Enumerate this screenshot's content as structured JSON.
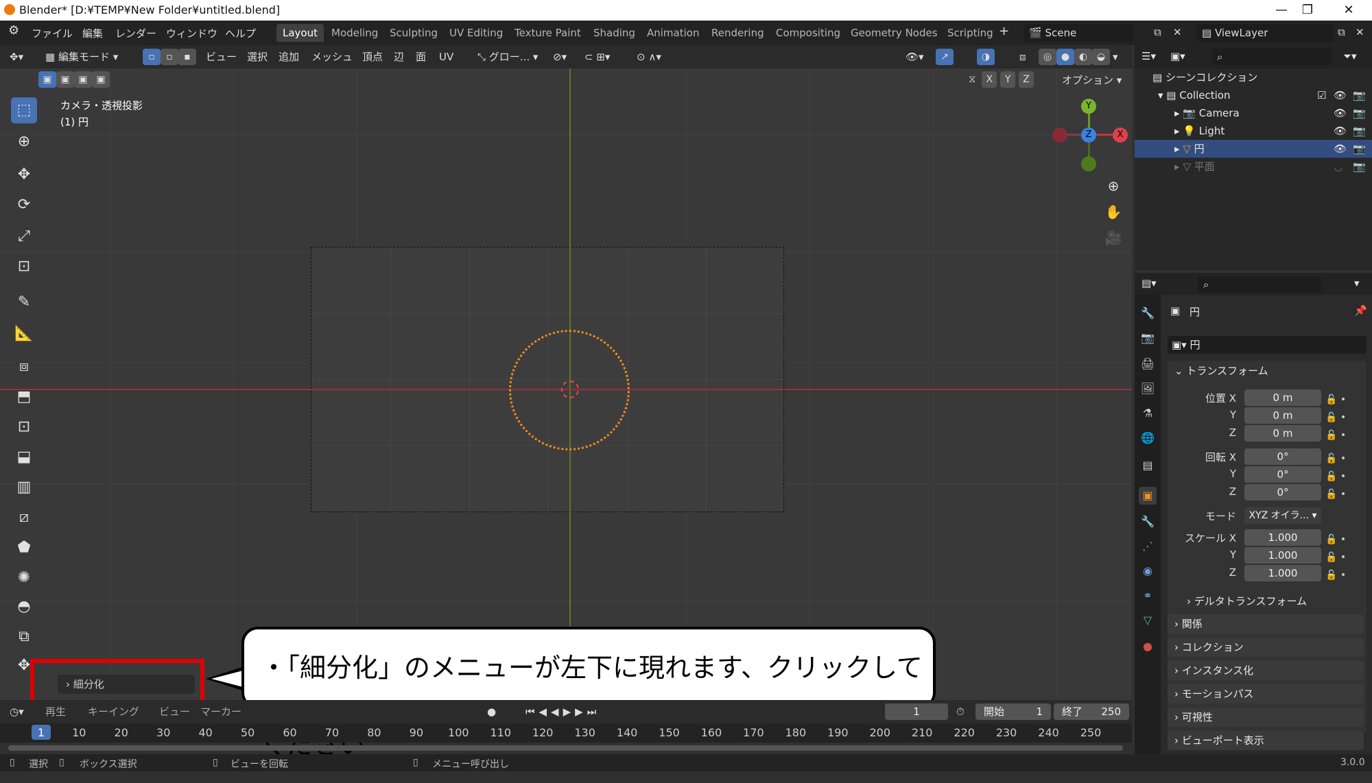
{
  "window": {
    "title": "Blender* [D:¥TEMP¥New Folder¥untitled.blend]",
    "minimize": "—",
    "maximize": "❐",
    "close": "✕"
  },
  "menu": [
    "ファイル",
    "編集",
    "レンダー",
    "ウィンドウ",
    "ヘルプ"
  ],
  "workspaces": [
    "Layout",
    "Modeling",
    "Sculpting",
    "UV Editing",
    "Texture Paint",
    "Shading",
    "Animation",
    "Rendering",
    "Compositing",
    "Geometry Nodes",
    "Scripting"
  ],
  "active_workspace": "Layout",
  "scene_name": "Scene",
  "view_layer": "ViewLayer",
  "viewport_header": {
    "mode": "編集モード",
    "menus": [
      "ビュー",
      "選択",
      "追加",
      "メッシュ",
      "頂点",
      "辺",
      "面",
      "UV"
    ],
    "transform_orientation": "グロー...",
    "options": "オプション",
    "axes": [
      "X",
      "Y",
      "Z"
    ]
  },
  "overlay_info": {
    "line1": "カメラ・透視投影",
    "line2": "(1) 円"
  },
  "gizmo": {
    "x": "X",
    "y": "Y",
    "z": "Z"
  },
  "operator_panel": {
    "label": "細分化"
  },
  "callout": {
    "text": "・「細分化」のメニューが左下に現れます、クリックしてください"
  },
  "timeline": {
    "menus": [
      "再生",
      "キーイング",
      "ビュー",
      "マーカー"
    ],
    "current_frame": "1",
    "start_label": "開始",
    "start": "1",
    "end_label": "終了",
    "end": "250",
    "ticks": [
      "1",
      "10",
      "20",
      "30",
      "40",
      "50",
      "60",
      "70",
      "80",
      "90",
      "100",
      "110",
      "120",
      "130",
      "140",
      "150",
      "160",
      "170",
      "180",
      "190",
      "200",
      "210",
      "220",
      "230",
      "240",
      "250"
    ]
  },
  "statusbar": {
    "select": "選択",
    "box_select": "ボックス選択",
    "rotate_view": "ビューを回転",
    "call_menu": "メニュー呼び出し",
    "version": "3.0.0"
  },
  "outliner": {
    "scene_collection": "シーンコレクション",
    "items": [
      {
        "name": "Collection",
        "indent": 1
      },
      {
        "name": "Camera",
        "indent": 2
      },
      {
        "name": "Light",
        "indent": 2
      },
      {
        "name": "円",
        "indent": 2,
        "selected": true
      },
      {
        "name": "平面",
        "indent": 2,
        "dimmed": true
      }
    ]
  },
  "properties": {
    "object_name": "円",
    "data_name": "円",
    "transform_header": "トランスフォーム",
    "location_label": "位置 X",
    "rotation_label": "回転 X",
    "scale_label": "スケール X",
    "mode_label": "モード",
    "y_label": "Y",
    "z_label": "Z",
    "location": [
      "0 m",
      "0 m",
      "0 m"
    ],
    "rotation": [
      "0°",
      "0°",
      "0°"
    ],
    "rotation_mode": "XYZ オイラ...",
    "scale": [
      "1.000",
      "1.000",
      "1.000"
    ],
    "delta": "デルタトランスフォーム",
    "panels": [
      "関係",
      "コレクション",
      "インスタンス化",
      "モーションパス",
      "可視性",
      "ビューポート表示"
    ]
  },
  "colors": {
    "accent": "#4772b3",
    "selection": "#f28c1c",
    "x_axis": "#c8323c",
    "y_axis": "#6b9a22",
    "callout_border": "#e00000"
  }
}
